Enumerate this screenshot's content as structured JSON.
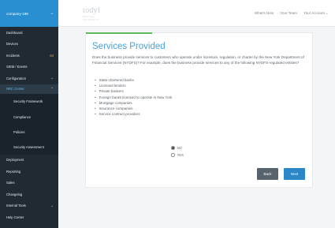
{
  "sidebar": {
    "company": "company-198",
    "items": [
      {
        "label": "Dashboard"
      },
      {
        "label": "Devices"
      },
      {
        "label": "Incidents",
        "badge": "64"
      },
      {
        "label": "SIEM / Events"
      },
      {
        "label": "Configuration",
        "chevron": "chevron-down-icon"
      },
      {
        "label": "NRC Center",
        "chevron": "chevron-up-icon"
      }
    ],
    "sub_items": [
      {
        "label": "Security Framework"
      },
      {
        "label": "Compliance"
      },
      {
        "label": "Policies"
      },
      {
        "label": "Security Assessment"
      }
    ],
    "bottom_items": [
      {
        "label": "Deployment"
      },
      {
        "label": "Reporting"
      },
      {
        "label": "Sales"
      },
      {
        "label": "Changelog"
      },
      {
        "label": "Internal Tools",
        "chevron": "chevron-down-icon"
      },
      {
        "label": "Help Center"
      }
    ]
  },
  "header": {
    "logo": "todyl",
    "logo_sub": "SECURE NETWORKS",
    "links": [
      "What's New",
      "Your Team",
      "Your Account ⌄"
    ]
  },
  "main": {
    "title": "Services Provided",
    "question": "Does the business provide services to customers who operate under licensure, regulation, or charter by the New York Department of Financial Services (NYDFS)? For example, does the business provide services to any of the following NYDFS-regulated entities?",
    "entities": [
      "State-chartered banks",
      "Licensed lenders",
      "Private bankers",
      "Foreign banks licensed to operate in New York",
      "Mortgage companies",
      "Insurance companies",
      "Service contract providers"
    ],
    "options": [
      {
        "label": "NO",
        "selected": true
      },
      {
        "label": "YES",
        "selected": false
      }
    ],
    "back_label": "Back",
    "next_label": "Next"
  },
  "colors": {
    "sidebar_bg": "#1f2a33",
    "accent": "#2a8fd0",
    "title": "#4a9fd8",
    "progress": "#5cb85c",
    "badge": "#f0ad4e"
  }
}
